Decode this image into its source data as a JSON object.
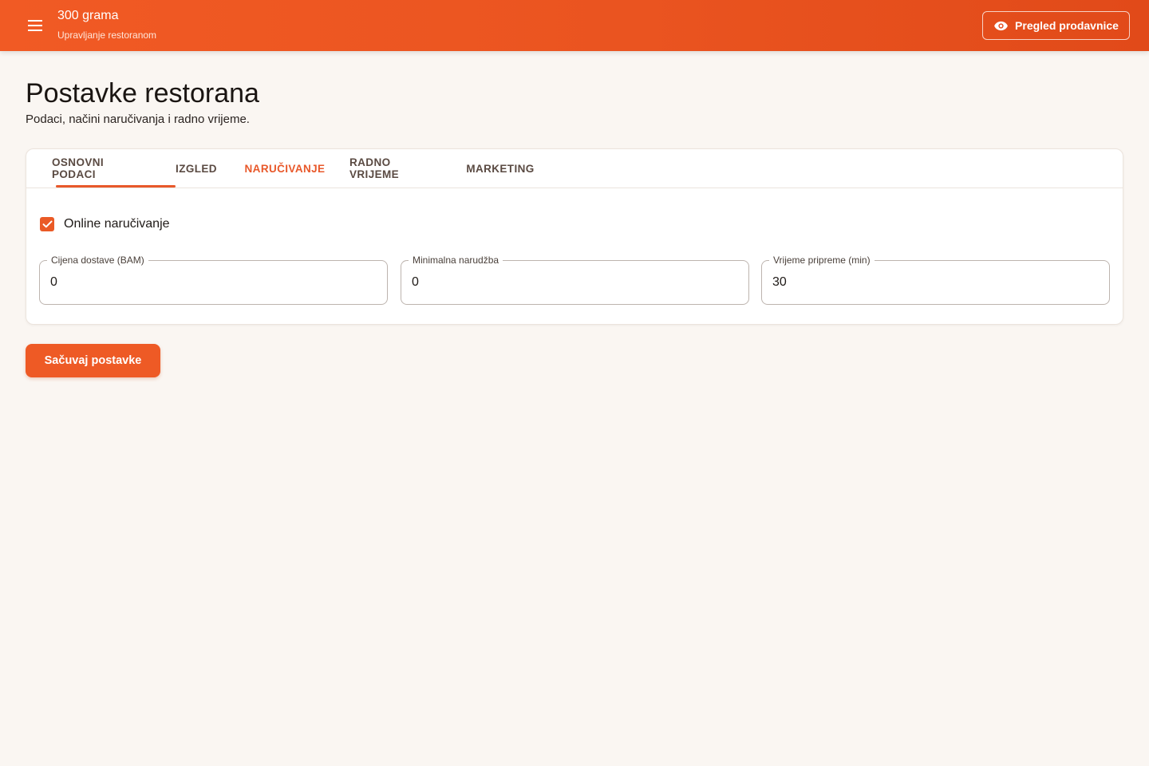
{
  "header": {
    "title": "300 grama",
    "subtitle": "Upravljanje restoranom",
    "menu_icon": "menu-icon",
    "preview_button": {
      "label": "Pregled prodavnice",
      "icon": "eye-icon"
    }
  },
  "page": {
    "title": "Postavke restorana",
    "subtitle": "Podaci, načini naručivanja i radno vrijeme."
  },
  "tabs": [
    {
      "label": "OSNOVNI PODACI",
      "active": false
    },
    {
      "label": "IZGLED",
      "active": false
    },
    {
      "label": "NARUČIVANJE",
      "active": true
    },
    {
      "label": "RADNO VRIJEME",
      "active": false
    },
    {
      "label": "MARKETING",
      "active": false
    }
  ],
  "ordering": {
    "online_ordering": {
      "label": "Online naručivanje",
      "checked": true
    },
    "fields": [
      {
        "label": "Cijena dostave (BAM)",
        "value": "0"
      },
      {
        "label": "Minimalna narudžba",
        "value": "0"
      },
      {
        "label": "Vrijeme pripreme (min)",
        "value": "30"
      }
    ]
  },
  "actions": {
    "save_label": "Sačuvaj postavke"
  },
  "colors": {
    "accent": "#ea5a26",
    "header_start": "#f15a24",
    "header_end": "#e14a19",
    "background": "#faf6f2"
  }
}
